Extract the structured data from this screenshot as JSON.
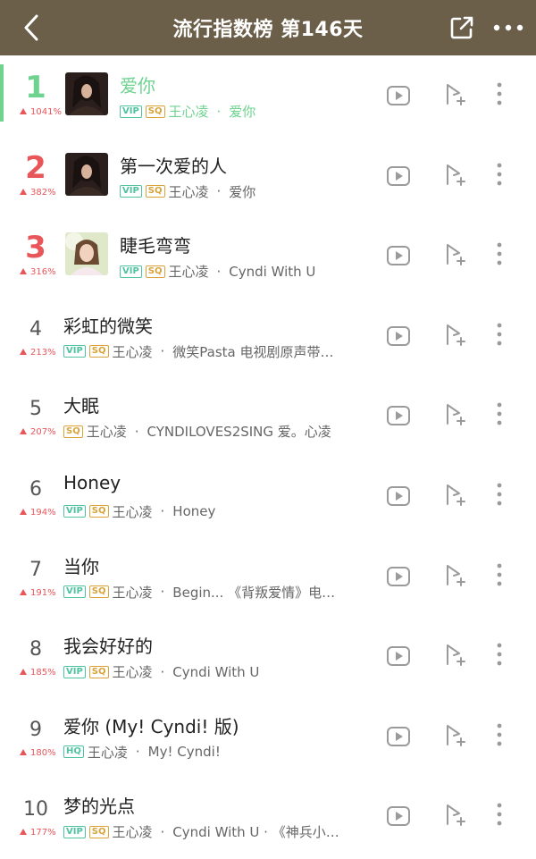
{
  "header": {
    "title": "流行指数榜 第146天",
    "bg_color": "#6b5f4a"
  },
  "colors": {
    "accent_green": "#6dd38f",
    "rank_red": "#e8565a",
    "vip": "#4fc3a0",
    "sq": "#d9a33a"
  },
  "songs": [
    {
      "rank": "1",
      "change": "1041%",
      "title": "爱你",
      "tags": [
        "VIP",
        "SQ"
      ],
      "artist": "王心凌",
      "album": "爱你",
      "active": true
    },
    {
      "rank": "2",
      "change": "382%",
      "title": "第一次爱的人",
      "tags": [
        "VIP",
        "SQ"
      ],
      "artist": "王心凌",
      "album": "爱你"
    },
    {
      "rank": "3",
      "change": "316%",
      "title": "睫毛弯弯",
      "tags": [
        "VIP",
        "SQ"
      ],
      "artist": "王心凌",
      "album": "Cyndi With U"
    },
    {
      "rank": "4",
      "change": "213%",
      "title": "彩虹的微笑",
      "tags": [
        "VIP",
        "SQ"
      ],
      "artist": "王心凌",
      "album": "微笑Pasta 电视剧原声带…"
    },
    {
      "rank": "5",
      "change": "207%",
      "title": "大眠",
      "tags": [
        "SQ"
      ],
      "artist": "王心凌",
      "album": "CYNDILOVES2SING 爱。心凌"
    },
    {
      "rank": "6",
      "change": "194%",
      "title": "Honey",
      "tags": [
        "VIP",
        "SQ"
      ],
      "artist": "王心凌",
      "album": "Honey"
    },
    {
      "rank": "7",
      "change": "191%",
      "title": "当你",
      "tags": [
        "VIP",
        "SQ"
      ],
      "artist": "王心凌",
      "album": "Begin... 《背叛爱情》电…"
    },
    {
      "rank": "8",
      "change": "185%",
      "title": "我会好好的",
      "tags": [
        "VIP",
        "SQ"
      ],
      "artist": "王心凌",
      "album": "Cyndi With U"
    },
    {
      "rank": "9",
      "change": "180%",
      "title": "爱你 (My! Cyndi! 版)",
      "tags": [
        "HQ"
      ],
      "artist": "王心凌",
      "album": "My! Cyndi!"
    },
    {
      "rank": "10",
      "change": "177%",
      "title": "梦的光点",
      "tags": [
        "VIP",
        "SQ"
      ],
      "artist": "王心凌",
      "album": "Cyndi With U · 《神兵小…"
    }
  ]
}
